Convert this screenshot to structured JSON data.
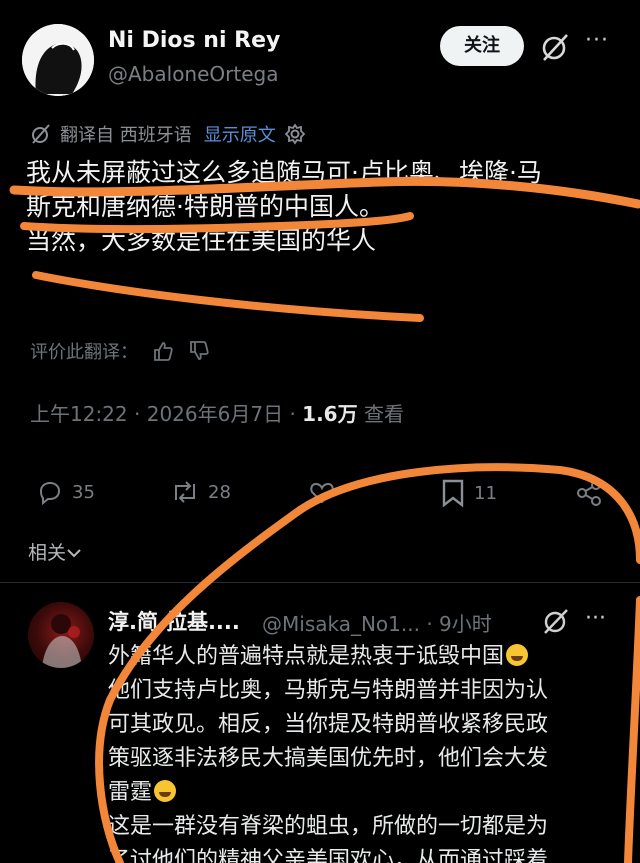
{
  "author": {
    "display_name": "Ni Dios ni Rey",
    "handle": "@AbaloneOrtega"
  },
  "header": {
    "follow_label": "关注",
    "more_label": "···"
  },
  "translation": {
    "translated_from": "翻译自 西班牙语",
    "show_original": "显示原文"
  },
  "tweet": {
    "lines": [
      "我从未屏蔽过这么多追随马可·卢比奥、埃隆·马",
      "斯克和唐纳德·特朗普的中国人。",
      "当然，大多数是住在美国的华人"
    ]
  },
  "rate_translation": "评价此翻译：",
  "meta": {
    "time": "上午12:22",
    "separator": "·",
    "date": "2026年6月7日",
    "views_count": "1.6万",
    "views_label": "查看"
  },
  "actions": {
    "replies": "35",
    "reposts": "28",
    "bookmarks": "11"
  },
  "related_label": "相关",
  "reply": {
    "display_name": "淳.简.拉基....",
    "handle_time": "@Misaka_No1... · 9小时",
    "more_label": "···",
    "lines": [
      {
        "text": "外籍华人的普遍特点就是热衷于诋毁中国",
        "emoji": "joy"
      },
      {
        "text": "他们支持卢比奥，马斯克与特朗普并非因为认"
      },
      {
        "text": "可其政见。相反，当你提及特朗普收紧移民政"
      },
      {
        "text": "策驱逐非法移民大搞美国优先时，他们会大发"
      },
      {
        "text": "雷霆",
        "emoji": "sweat"
      },
      {
        "text": "这是一群没有脊梁的蛆虫，所做的一切都是为"
      },
      {
        "text": "了讨他们的精神父亲美国欢心，从而通过踩着"
      }
    ]
  },
  "colors": {
    "annotation": "#f2873a",
    "link": "#5c8fd8",
    "background": "#000000"
  }
}
